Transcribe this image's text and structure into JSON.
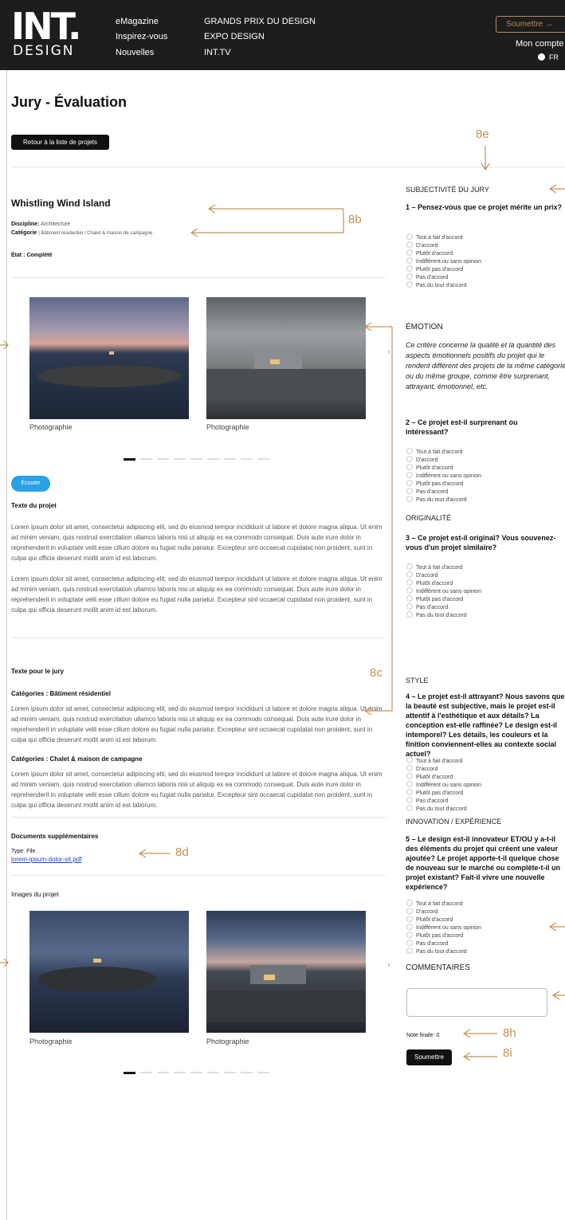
{
  "header": {
    "logo_top": "INT.",
    "logo_bottom": "DESIGN",
    "nav_col1": [
      "eMagazine",
      "Inspirez-vous",
      "Nouvelles"
    ],
    "nav_col2": [
      "GRANDS PRIX DU DESIGN",
      "EXPO DESIGN",
      "INT.TV"
    ],
    "submit_label": "Soumettre →",
    "account_label": "Mon compte",
    "lang_label": "FR"
  },
  "page": {
    "title": "Jury - Évaluation",
    "back_label": "Retour à la liste de projets"
  },
  "project": {
    "name": "Whistling Wind Island",
    "discipline_key": "Discipline:",
    "discipline_val": "Architecture",
    "category_key": "Catégorie",
    "category_val": "| Bâtiment résidentiel / Chalet & maison de campagne",
    "state": "État : Complété",
    "photo_caption": "Photographie"
  },
  "texts": {
    "listen_label": "Écouter",
    "project_text_heading": "Texte du projet",
    "lorem": "Lorem ipsum dolor sit amet, consectetur adipiscing elit, sed do eiusmod tempor incididunt ut labore et dolore magna aliqua. Ut enim ad minim veniam, quis nostrud exercitation ullamco laboris nisi ut aliquip ex ea commodo consequat. Duis aute irure dolor in reprehenderit in voluptate velit esse cillum dolore eu fugiat nulla pariatur. Excepteur sint occaecat cupidatat non proident, sunt in culpa qui officia deserunt mollit anim id est laborum.",
    "jury_text_heading": "Texte pour le jury",
    "cat1_heading": "Catégories : Bâtiment résidentiel",
    "cat2_heading": "Catégories : Chalet & maison de campagne"
  },
  "documents": {
    "heading": "Documents supplémentaires",
    "type_label": "Type: File",
    "file_link": "lorem-ipsum-dolor-sit.pdf"
  },
  "images_heading": "Images du projet",
  "evaluation": {
    "options": [
      "Tout à fait d'accord",
      "D'accord",
      "Plutôt d'accord",
      "Indifférent ou sans opinion",
      "Plutôt pas d'accord",
      "Pas d'accord",
      "Pas du tout d'accord"
    ],
    "s1_title": "SUBJECTIVITÉ DU JURY",
    "q1": "1 – Pensez-vous que ce projet mérite un prix?",
    "s2_title": "ÉMOTION",
    "s2_desc": "Ce critère concerne la qualité et la quantité des aspects émotionnels positifs du projet qui le rendent différent des projets de la même catégorie ou du même groupe, comme être surprenant, attrayant, émotionnel, etc.",
    "q2": "2 – Ce projet est-il surprenant ou intéressant?",
    "s3_title": "ORIGINALITÉ",
    "q3": "3 – Ce projet est-il original? Vous souvenez-vous d'un projet similaire?",
    "s4_title": "STYLE",
    "q4": "4 – Le projet est-il attrayant? Nous savons que la beauté est subjective, mais le projet est-il attentif à l'esthétique et aux détails? La conception est-elle raffinée? Le design est-il intemporel? Les détails, les couleurs et la finition conviennent-elles au contexte social actuel?",
    "s5_title": "INNOVATION / EXPÉRIENCE",
    "q5": "5 – Le design est-il innovateur ET/OU y a-t-il des éléments du projet qui créent une valeur ajoutée? Le projet apporte-t-il quelque chose de nouveau sur le marché ou complète-t-il un projet existant? Fait-il vivre une nouvelle expérience?",
    "comments_title": "COMMENTAIRES",
    "final_note": "Note finale: 0",
    "submit_label": "Soumettre"
  },
  "annotations": [
    "8b",
    "8c",
    "8d",
    "8e",
    "8h",
    "8i"
  ],
  "colors": {
    "header_bg": "#1d1d1d",
    "accent": "#c4924f",
    "listen_blue": "#29a1e6"
  }
}
